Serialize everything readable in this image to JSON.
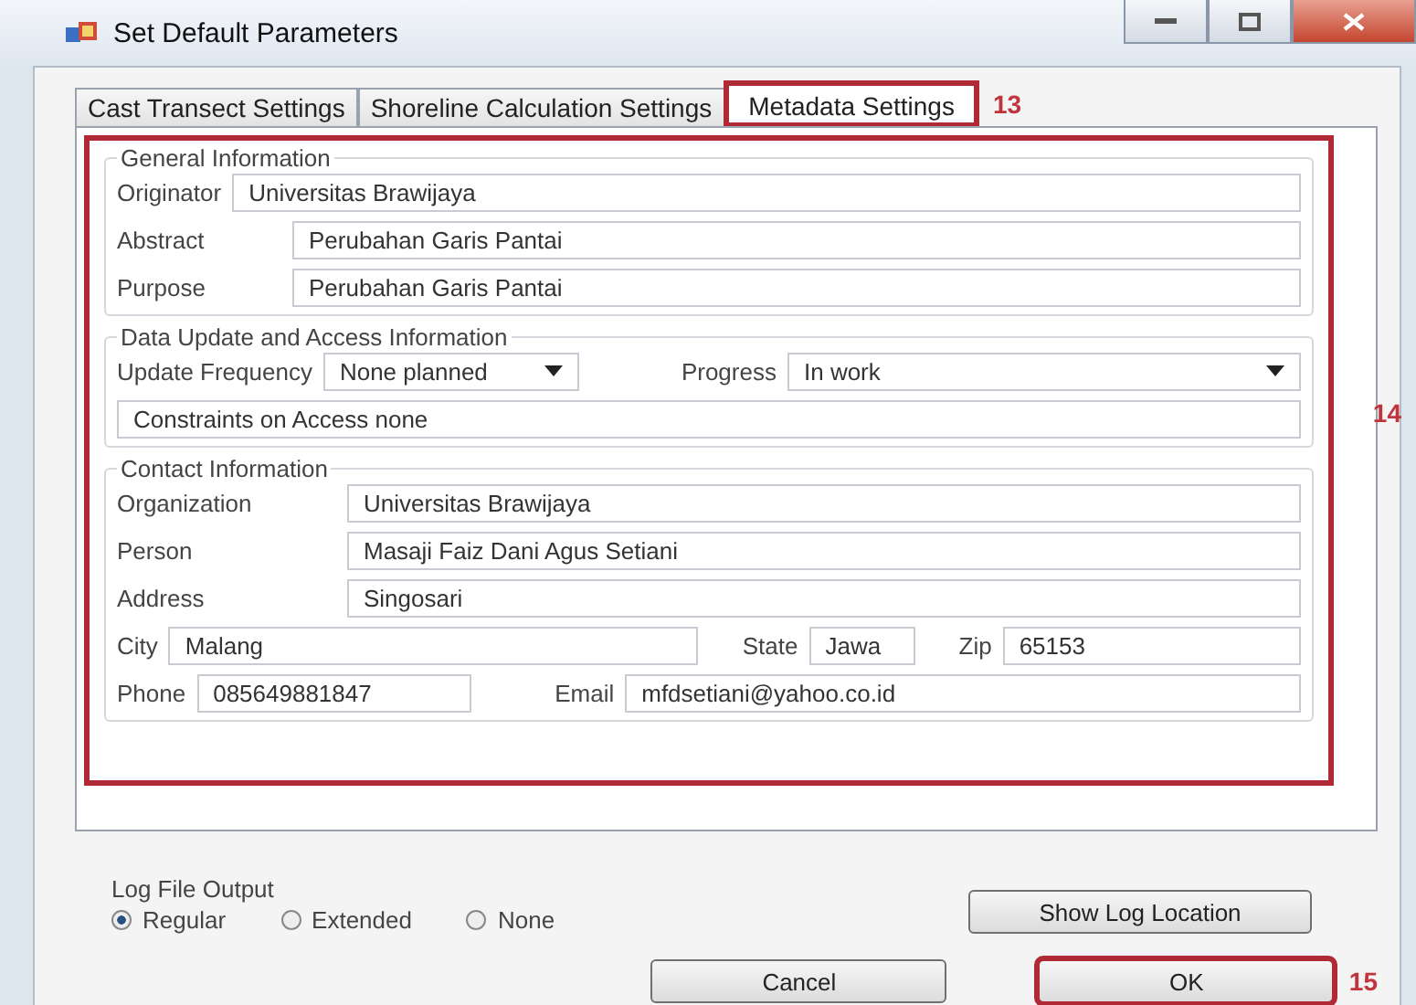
{
  "window": {
    "title": "Set Default Parameters"
  },
  "tabs": [
    {
      "label": "Cast Transect Settings",
      "selected": false
    },
    {
      "label": "Shoreline Calculation Settings",
      "selected": false
    },
    {
      "label": "Metadata Settings",
      "selected": true,
      "annotation": "13"
    }
  ],
  "panel": {
    "annotation": "14"
  },
  "general_information": {
    "title": "General Information",
    "fields": [
      {
        "label": "Originator",
        "value": "Universitas Brawijaya"
      },
      {
        "label": "Abstract",
        "value": "Perubahan Garis Pantai"
      },
      {
        "label": "Purpose",
        "value": "Perubahan Garis Pantai"
      }
    ]
  },
  "data_update": {
    "title": "Data Update and Access Information",
    "update_frequency": {
      "label": "Update Frequency",
      "value": "None planned"
    },
    "progress": {
      "label": "Progress",
      "value": "In work"
    },
    "constraints": {
      "label": "Constraints on Access",
      "value": "none"
    }
  },
  "contact": {
    "title": "Contact Information",
    "fields": [
      {
        "label": "Organization",
        "value": "Universitas Brawijaya"
      },
      {
        "label": "Person",
        "value": "Masaji Faiz Dani Agus Setiani"
      },
      {
        "label": "Address",
        "value": "Singosari"
      }
    ],
    "city": {
      "label": "City",
      "value": "Malang"
    },
    "state": {
      "label": "State",
      "value": "Jawa"
    },
    "zip": {
      "label": "Zip",
      "value": "65153"
    },
    "phone": {
      "label": "Phone",
      "value": "085649881847"
    },
    "email": {
      "label": "Email",
      "value": "mfdsetiani@yahoo.co.id"
    }
  },
  "log_file_output": {
    "title": "Log File Output",
    "options": [
      {
        "label": "Regular",
        "selected": true
      },
      {
        "label": "Extended",
        "selected": false
      },
      {
        "label": "None",
        "selected": false
      }
    ],
    "show_log_button": "Show Log Location"
  },
  "buttons": [
    {
      "label": "Cancel"
    },
    {
      "label": "OK",
      "annotation": "15"
    }
  ]
}
